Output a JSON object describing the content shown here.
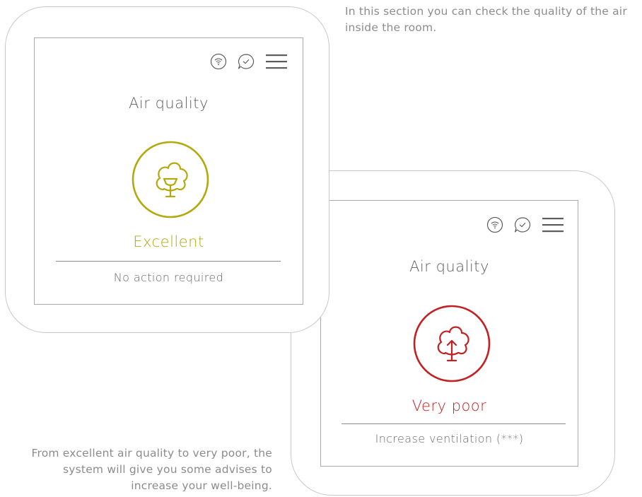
{
  "intro_caption": "In this section you can check the quality of the air inside the room.",
  "outro_caption": "From excellent air quality to very poor, the system will give you some advises to increase your well-being.",
  "colors": {
    "excellent": "#b3a90c",
    "very_poor": "#c32024",
    "icon_gray": "#5d5d5d",
    "frame": "#c8c8c8"
  },
  "panels": [
    {
      "title": "Air quality",
      "status": "Excellent",
      "action": "No action required",
      "icons": [
        "wifi-icon",
        "chat-check-icon",
        "menu-icon"
      ]
    },
    {
      "title": "Air quality",
      "status": "Very poor",
      "action": "Increase ventilation (***)",
      "icons": [
        "wifi-icon",
        "chat-check-icon",
        "menu-icon"
      ]
    }
  ]
}
